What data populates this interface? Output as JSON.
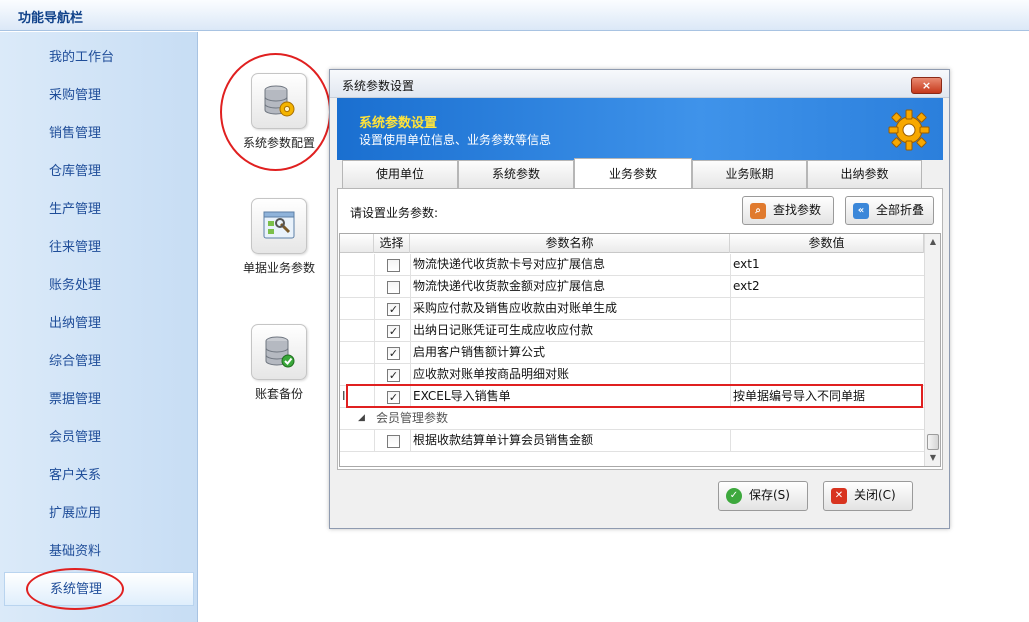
{
  "topbar": {
    "title": "功能导航栏"
  },
  "sidebar": {
    "items": [
      {
        "label": "我的工作台"
      },
      {
        "label": "采购管理"
      },
      {
        "label": "销售管理"
      },
      {
        "label": "仓库管理"
      },
      {
        "label": "生产管理"
      },
      {
        "label": "往来管理"
      },
      {
        "label": "账务处理"
      },
      {
        "label": "出纳管理"
      },
      {
        "label": "综合管理"
      },
      {
        "label": "票据管理"
      },
      {
        "label": "会员管理"
      },
      {
        "label": "客户关系"
      },
      {
        "label": "扩展应用"
      },
      {
        "label": "基础资料"
      },
      {
        "label": "系统管理"
      }
    ],
    "active": "系统管理"
  },
  "tools": [
    {
      "label": "系统参数配置",
      "icon": "database-gear-icon"
    },
    {
      "label": "单据业务参数",
      "icon": "document-settings-icon"
    },
    {
      "label": "账套备份",
      "icon": "database-backup-icon"
    }
  ],
  "dialog": {
    "title": "系统参数设置",
    "close_label": "×",
    "banner": {
      "title": "系统参数设置",
      "subtitle": "设置使用单位信息、业务参数等信息"
    },
    "tabs": [
      {
        "label": "使用单位"
      },
      {
        "label": "系统参数"
      },
      {
        "label": "业务参数"
      },
      {
        "label": "业务账期"
      },
      {
        "label": "出纳参数"
      }
    ],
    "active_tab": "业务参数",
    "panel_label": "请设置业务参数:",
    "find_button": "查找参数",
    "collapse_button": "全部折叠",
    "grid": {
      "headers": {
        "select": "选择",
        "name": "参数名称",
        "value": "参数值"
      },
      "rows": [
        {
          "checked": false,
          "name": "物流快递代收货款卡号对应扩展信息",
          "value": "ext1"
        },
        {
          "checked": false,
          "name": "物流快递代收货款金额对应扩展信息",
          "value": "ext2"
        },
        {
          "checked": true,
          "name": "采购应付款及销售应收款由对账单生成",
          "value": ""
        },
        {
          "checked": true,
          "name": "出纳日记账凭证可生成应收应付款",
          "value": ""
        },
        {
          "checked": true,
          "name": "启用客户销售额计算公式",
          "value": ""
        },
        {
          "checked": true,
          "name": "应收款对账单按商品明细对账",
          "value": ""
        },
        {
          "checked": true,
          "name": "EXCEL导入销售单",
          "value": "按单据编号导入不同单据"
        }
      ],
      "current_row_marker": "I",
      "group": {
        "label": "会员管理参数",
        "expander": "◢"
      },
      "group_rows": [
        {
          "checked": false,
          "name": "根据收款结算单计算会员销售金额",
          "value": ""
        }
      ]
    },
    "save_button": "保存(S)",
    "close_button": "关闭(C)"
  },
  "colors": {
    "nav_text": "#1f4d99",
    "banner_blue": "#2b7fdc",
    "banner_title": "#ffe33a",
    "highlight_red": "#e02020"
  }
}
